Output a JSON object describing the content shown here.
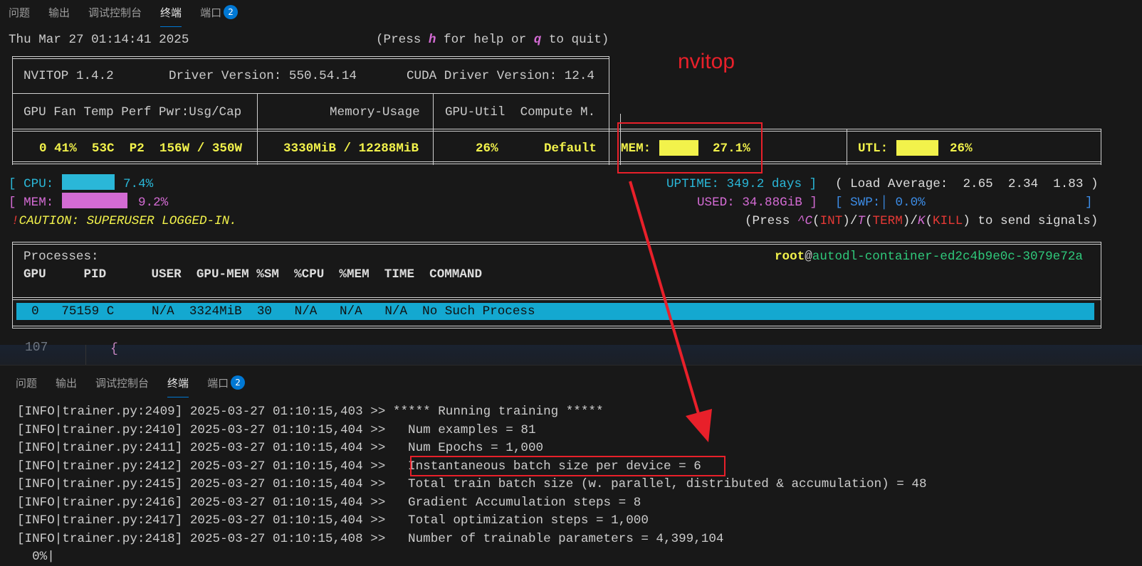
{
  "tabs": [
    {
      "label": "问题"
    },
    {
      "label": "输出"
    },
    {
      "label": "调试控制台"
    },
    {
      "label": "终端",
      "active": true
    },
    {
      "label": "端口",
      "badge": "2"
    }
  ],
  "nvitop": {
    "datetime": "Thu Mar 27 01:14:41 2025",
    "help": {
      "a": "(Press ",
      "h": "h",
      "b": " for help or ",
      "q": "q",
      "c": " to quit)"
    },
    "version": "NVITOP 1.4.2",
    "driver": "Driver Version: 550.54.14",
    "cuda": "CUDA Driver Version: 12.4",
    "hdr1": "GPU Fan Temp Perf Pwr:Usg/Cap",
    "hdr2": "Memory-Usage",
    "hdr3": "GPU-Util  Compute M.",
    "gpu_row": {
      "stats": "0 41%  53C  P2  156W / 350W",
      "mem": "3330MiB / 12288MiB",
      "util": "26%",
      "compute": "Default"
    },
    "mem_gauge": {
      "label": "MEM:",
      "value": "27.1%",
      "fraction": 0.271
    },
    "utl_gauge": {
      "label": "UTL:",
      "value": "26%",
      "fraction": 0.26
    },
    "cpu": {
      "bracket": "[",
      "label": "CPU:",
      "value": "7.4%",
      "fraction": 0.074
    },
    "host_mem": {
      "bracket": "[",
      "label": "MEM:",
      "value": "9.2%",
      "fraction": 0.092
    },
    "uptime": {
      "label": "UPTIME:",
      "value": "349.2 days",
      "close": "]"
    },
    "load": "( Load Average:  2.65  2.34  1.83 )",
    "used": {
      "label": "USED:",
      "value": "34.88GiB",
      "close": "]"
    },
    "swp": {
      "open": "[",
      "label": "SWP:",
      "value": "0.0%",
      "close": "]"
    },
    "caution": {
      "bang": "!",
      "text": "CAUTION: SUPERUSER LOGGED-IN."
    },
    "signals": {
      "a": "(Press ",
      "c": "^C",
      "p1": "(",
      "int": "INT",
      "p2": ")/",
      "t": "T",
      "p3": "(",
      "term": "TERM",
      "p4": ")/",
      "k": "K",
      "p5": "(",
      "kill": "KILL",
      "p6": ") to send signals)"
    },
    "processes_title": "Processes:",
    "host": {
      "user": "root",
      "at": "@",
      "name": "autodl-container-ed2c4b9e0c-3079e72a"
    },
    "proc_header": "GPU     PID      USER  GPU-MEM %SM  %CPU  %MEM  TIME  COMMAND",
    "proc_row": "  0   75159 C     N/A  3324MiB  30   N/A   N/A   N/A  No Such Process"
  },
  "annotation": {
    "label": "nvitop"
  },
  "editor_line": {
    "num": "107",
    "code": "{"
  },
  "log": [
    {
      "p": "[INFO|trainer.py:2409] 2025-03-27 01:10:15,403 >> ",
      "t": "***** Running training *****"
    },
    {
      "p": "[INFO|trainer.py:2410] 2025-03-27 01:10:15,404 >> ",
      "t": "  Num examples = 81"
    },
    {
      "p": "[INFO|trainer.py:2411] 2025-03-27 01:10:15,404 >> ",
      "t": "  Num Epochs = 1,000"
    },
    {
      "p": "[INFO|trainer.py:2412] 2025-03-27 01:10:15,404 >> ",
      "t": "  Instantaneous batch size per device = 6"
    },
    {
      "p": "[INFO|trainer.py:2415] 2025-03-27 01:10:15,404 >> ",
      "t": "  Total train batch size (w. parallel, distributed & accumulation) = 48"
    },
    {
      "p": "[INFO|trainer.py:2416] 2025-03-27 01:10:15,404 >> ",
      "t": "  Gradient Accumulation steps = 8"
    },
    {
      "p": "[INFO|trainer.py:2417] 2025-03-27 01:10:15,404 >> ",
      "t": "  Total optimization steps = 1,000"
    },
    {
      "p": "[INFO|trainer.py:2418] 2025-03-27 01:10:15,408 >> ",
      "t": "  Number of trainable parameters = 4,399,104"
    }
  ],
  "progress_fragment": "  0%|"
}
